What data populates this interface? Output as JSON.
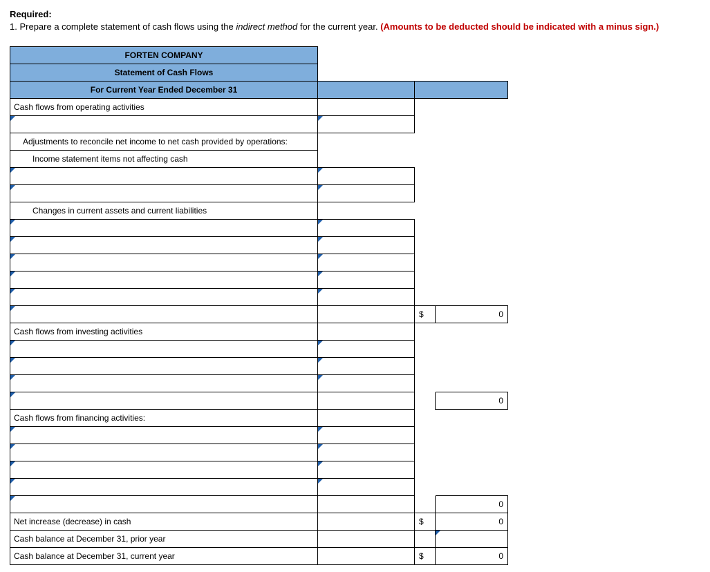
{
  "required_label": "Required:",
  "instruction_prefix": "1. ",
  "instruction_main": "Prepare a complete statement of cash flows using the ",
  "instruction_italic": "indirect method",
  "instruction_mid": " for the current year. ",
  "instruction_red": "(Amounts to be deducted should be indicated with a minus sign.)",
  "title_company": "FORTEN COMPANY",
  "title_statement": "Statement of Cash Flows",
  "title_period": "For Current Year Ended December 31",
  "labels": {
    "op_header": "Cash flows from operating activities",
    "adjustments": "Adjustments to reconcile net income to net cash provided by operations:",
    "income_items": "Income statement items not affecting cash",
    "changes": "Changes in current assets and current liabilities",
    "inv_header": "Cash flows from investing activities",
    "fin_header": "Cash flows from financing activities:",
    "net_increase": "Net increase (decrease) in cash",
    "prior_balance": "Cash balance at December 31, prior year",
    "current_balance": "Cash balance at December 31, current year"
  },
  "currency": "$",
  "zero": "0"
}
